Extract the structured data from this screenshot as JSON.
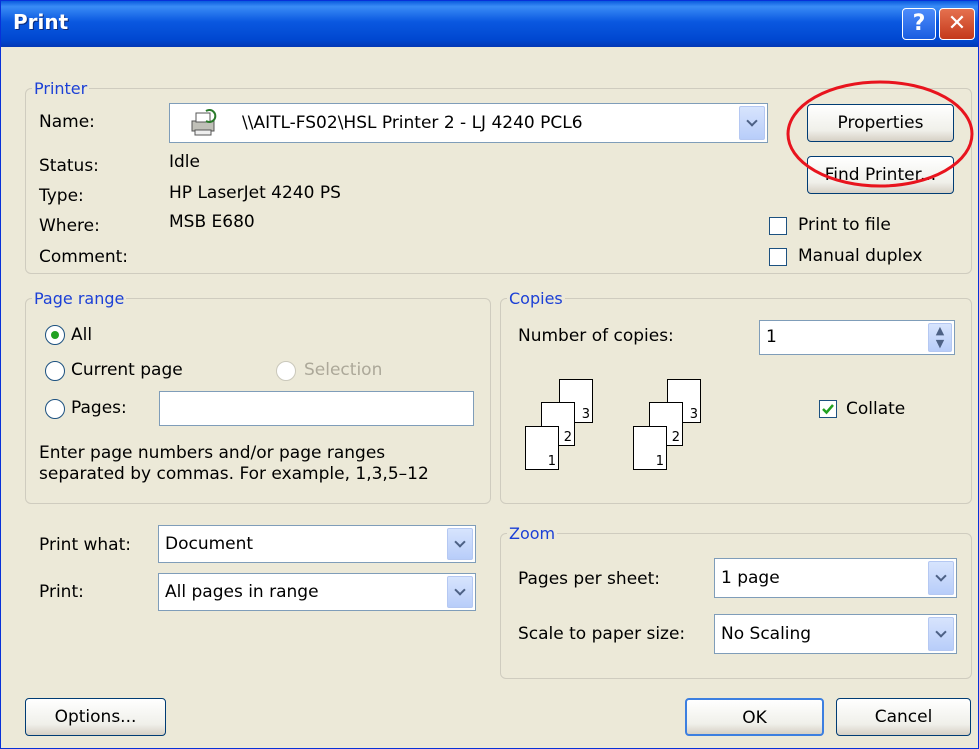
{
  "window": {
    "title": "Print"
  },
  "printer": {
    "group_label": "Printer",
    "name_label": "Name:",
    "name_value": "\\\\AITL-FS02\\HSL Printer 2 - LJ 4240 PCL6",
    "status_label": "Status:",
    "status_value": "Idle",
    "type_label": "Type:",
    "type_value": "HP LaserJet 4240 PS",
    "where_label": "Where:",
    "where_value": "MSB E680",
    "comment_label": "Comment:",
    "properties_button": "Properties",
    "find_printer_button": "Find Printer...",
    "print_to_file_label": "Print to file",
    "print_to_file_checked": false,
    "manual_duplex_label": "Manual duplex",
    "manual_duplex_checked": false
  },
  "page_range": {
    "group_label": "Page range",
    "all_label": "All",
    "current_page_label": "Current page",
    "selection_label": "Selection",
    "pages_label": "Pages:",
    "pages_value": "",
    "selected": "All",
    "help_line1": "Enter page numbers and/or page ranges",
    "help_line2": "separated by commas.  For example, 1,3,5–12"
  },
  "copies": {
    "group_label": "Copies",
    "number_label": "Number of copies:",
    "number_value": "1",
    "collate_label": "Collate",
    "collate_checked": true,
    "stack_pages": [
      "3",
      "2",
      "1"
    ]
  },
  "print_what": {
    "label": "Print what:",
    "value": "Document"
  },
  "print": {
    "label": "Print:",
    "value": "All pages in range"
  },
  "zoom": {
    "group_label": "Zoom",
    "pages_per_sheet_label": "Pages per sheet:",
    "pages_per_sheet_value": "1 page",
    "scale_label": "Scale to paper size:",
    "scale_value": "No Scaling"
  },
  "buttons": {
    "options": "Options...",
    "ok": "OK",
    "cancel": "Cancel"
  },
  "colors": {
    "annotation_circle": "#e8141e",
    "group_label": "#1c40d6",
    "title_bar": "#0a58e0"
  }
}
